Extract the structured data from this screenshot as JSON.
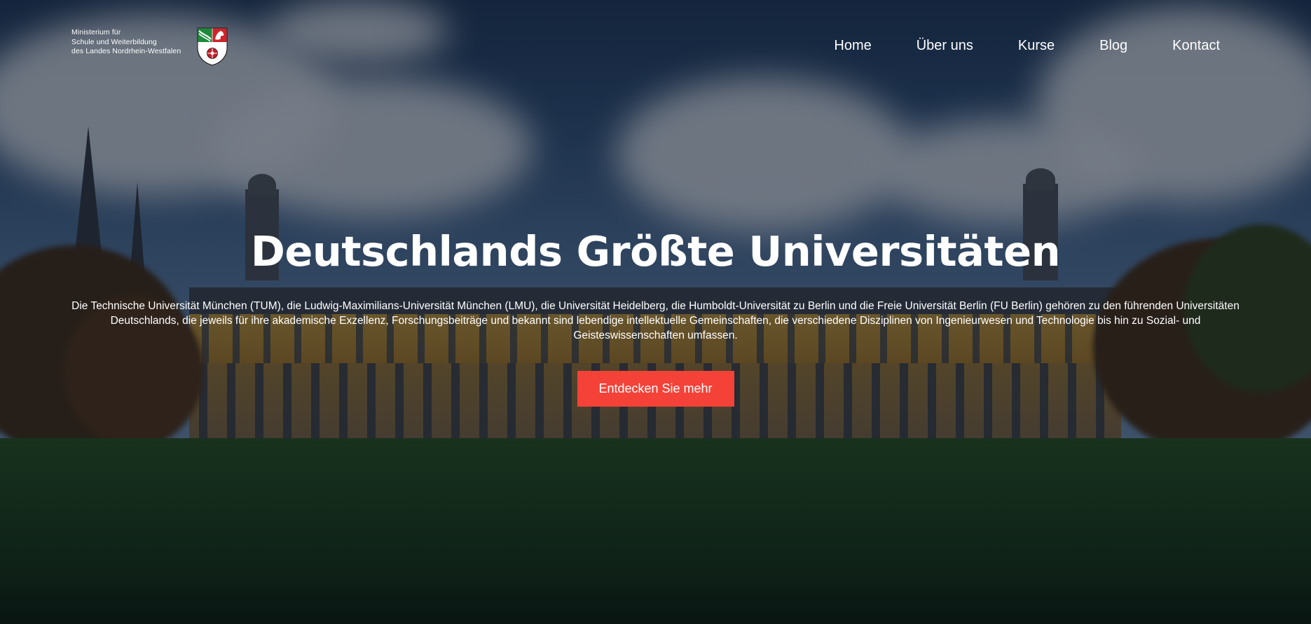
{
  "header": {
    "logo": {
      "lines": [
        "Ministerium für",
        "Schule und Weiterbildung",
        "des Landes Nordrhein-Westfalen"
      ],
      "crest_icon": "nrw-coat-of-arms-icon"
    },
    "nav": [
      {
        "label": "Home"
      },
      {
        "label": "Über uns"
      },
      {
        "label": "Kurse"
      },
      {
        "label": "Blog"
      },
      {
        "label": "Kontact"
      }
    ]
  },
  "hero": {
    "title": "Deutschlands Größte Universitäten",
    "text": "Die Technische Universität München (TUM), die Ludwig-Maximilians-Universität München (LMU), die Universität Heidelberg, die Humboldt-Universität zu Berlin und die Freie Universität Berlin (FU Berlin) gehören zu den führenden Universitäten Deutschlands, die jeweils für ihre akademische Exzellenz, Forschungsbeiträge und bekannt sind lebendige intellektuelle Gemeinschaften, die verschiedene Disziplinen von Ingenieurwesen und Technologie bis hin zu Sozial- und Geisteswissenschaften umfassen.",
    "cta_label": "Entdecken Sie mehr"
  },
  "colors": {
    "cta": "#f44238",
    "text": "#ffffff",
    "overlay": "#060e1a"
  }
}
